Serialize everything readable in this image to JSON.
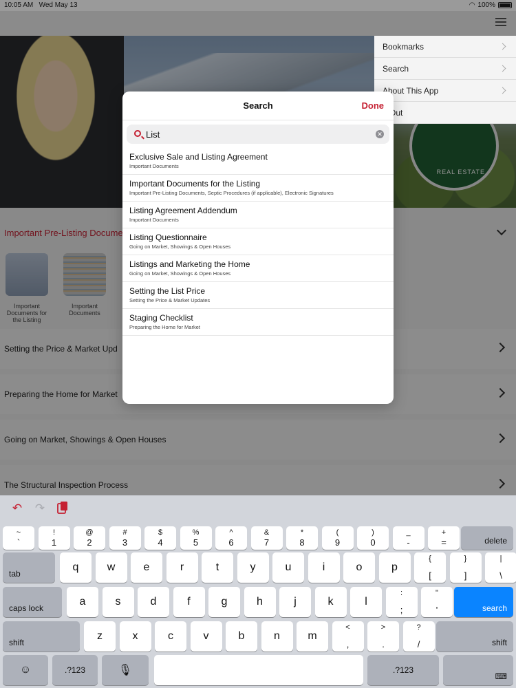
{
  "status": {
    "time": "10:05 AM",
    "date": "Wed May 13",
    "battery": "100%"
  },
  "hero": {
    "logo_text": "REAL ESTATE"
  },
  "section": {
    "title": "Important Pre-Listing Documen",
    "tiles": [
      {
        "label": "Important Documents for the Listing"
      },
      {
        "label": "Important Documents"
      }
    ]
  },
  "rows": [
    {
      "label": "Setting the Price & Market Upd"
    },
    {
      "label": "Preparing the Home for Market"
    },
    {
      "label": "Going on Market, Showings & Open Houses"
    },
    {
      "label": "The Structural Inspection Process"
    }
  ],
  "side_menu": {
    "items": [
      {
        "label": "Bookmarks"
      },
      {
        "label": "Search"
      },
      {
        "label": "About This App"
      },
      {
        "label": "g Out"
      }
    ]
  },
  "modal": {
    "title": "Search",
    "done_label": "Done",
    "query": "List",
    "results": [
      {
        "title": "Exclusive Sale and Listing Agreement",
        "subtitle": "Important Documents"
      },
      {
        "title": "Important Documents for the Listing",
        "subtitle": "Important Pre-Listing Documents, Septic Procedures (if applicable), Electronic Signatures"
      },
      {
        "title": "Listing Agreement Addendum",
        "subtitle": "Important Documents"
      },
      {
        "title": "Listing Questionnaire",
        "subtitle": "Going on Market, Showings & Open Houses"
      },
      {
        "title": "Listings and Marketing the Home",
        "subtitle": "Going on Market, Showings & Open Houses"
      },
      {
        "title": "Setting the List Price",
        "subtitle": "Setting the Price & Market Updates"
      },
      {
        "title": "Staging Checklist",
        "subtitle": "Preparing the Home for Market"
      }
    ]
  },
  "keyboard": {
    "toolbar": {
      "undo": "↶",
      "redo": "↷",
      "paste": "paste-icon"
    },
    "num_row": [
      {
        "top": "~",
        "bot": "`"
      },
      {
        "top": "!",
        "bot": "1"
      },
      {
        "top": "@",
        "bot": "2"
      },
      {
        "top": "#",
        "bot": "3"
      },
      {
        "top": "$",
        "bot": "4"
      },
      {
        "top": "%",
        "bot": "5"
      },
      {
        "top": "^",
        "bot": "6"
      },
      {
        "top": "&",
        "bot": "7"
      },
      {
        "top": "*",
        "bot": "8"
      },
      {
        "top": "(",
        "bot": "9"
      },
      {
        "top": ")",
        "bot": "0"
      },
      {
        "top": "_",
        "bot": "-"
      },
      {
        "top": "+",
        "bot": "="
      }
    ],
    "delete": "delete",
    "tab": "tab",
    "row_q": [
      "q",
      "w",
      "e",
      "r",
      "t",
      "y",
      "u",
      "i",
      "o",
      "p"
    ],
    "row_q_sym": [
      {
        "top": "{",
        "bot": "["
      },
      {
        "top": "}",
        "bot": "]"
      },
      {
        "top": "|",
        "bot": "\\"
      }
    ],
    "caps": "caps lock",
    "row_a": [
      "a",
      "s",
      "d",
      "f",
      "g",
      "h",
      "j",
      "k",
      "l"
    ],
    "row_a_sym": [
      {
        "top": ":",
        "bot": ";"
      },
      {
        "top": "\"",
        "bot": "'"
      }
    ],
    "search": "search",
    "shift_left": "shift",
    "row_z": [
      "z",
      "x",
      "c",
      "v",
      "b",
      "n",
      "m"
    ],
    "row_z_sym": [
      {
        "top": "<",
        "bot": ","
      },
      {
        "top": ">",
        "bot": "."
      },
      {
        "top": "?",
        "bot": "/"
      }
    ],
    "shift_right": "shift",
    "emoji": "☺",
    "num_left": ".?123",
    "mic": "🎙",
    "num_right": ".?123",
    "hide": "⌨"
  }
}
